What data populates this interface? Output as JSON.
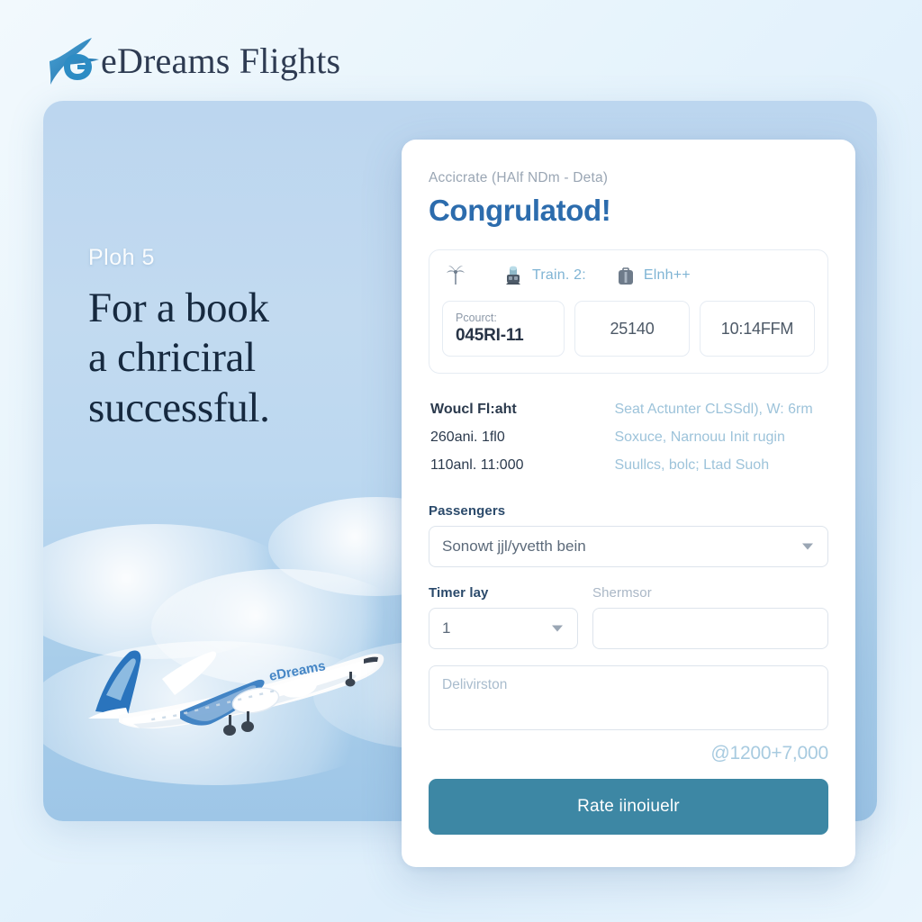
{
  "brand": {
    "name": "eDreams Flights",
    "mark": "e-swoosh-logo"
  },
  "hero": {
    "eyebrow": "Ploh 5",
    "headline_line1": "For a book",
    "headline_line2": "a chriciral",
    "headline_line3": "successful.",
    "image": "airplane-taking-off"
  },
  "card": {
    "kicker": "Accicrate (HAlf NDm - Deta)",
    "title": "Congrulatod!",
    "summary": {
      "items": [
        {
          "icon": "palm-tree-icon",
          "label": ""
        },
        {
          "icon": "train-icon",
          "label": "Train. 2:"
        },
        {
          "icon": "luggage-icon",
          "label": "Elnh++"
        }
      ],
      "boxes": [
        {
          "label": "Pcourct:",
          "value": "045RI-11"
        },
        {
          "label": "",
          "value": "25140"
        },
        {
          "label": "",
          "value": "10:14FFM"
        }
      ]
    },
    "details": {
      "left": [
        "Woucl Fl:aht",
        "260ani. 1fl0",
        "110anl. 11:000"
      ],
      "right": [
        "Seat Actunter CLSSdl), W: 6rm",
        "Soxuce, Narnouu Init rugin",
        "Suullcs, bolc; Ltad Suoh"
      ]
    },
    "form": {
      "passengers_label": "Passengers",
      "passengers_value": "Sonowt jjl/yvetth bein",
      "timer_label": "Timer lay",
      "timer_value": "1",
      "shermsor_label": "Shermsor",
      "shermsor_value": "",
      "note_placeholder": "Delivirston",
      "price": "@1200+7,000",
      "cta": "Rate iinoiuelr"
    }
  },
  "colors": {
    "accent": "#3d87a4",
    "title": "#2c6cad",
    "headline": "#16293f",
    "muted": "#9dc3da"
  }
}
